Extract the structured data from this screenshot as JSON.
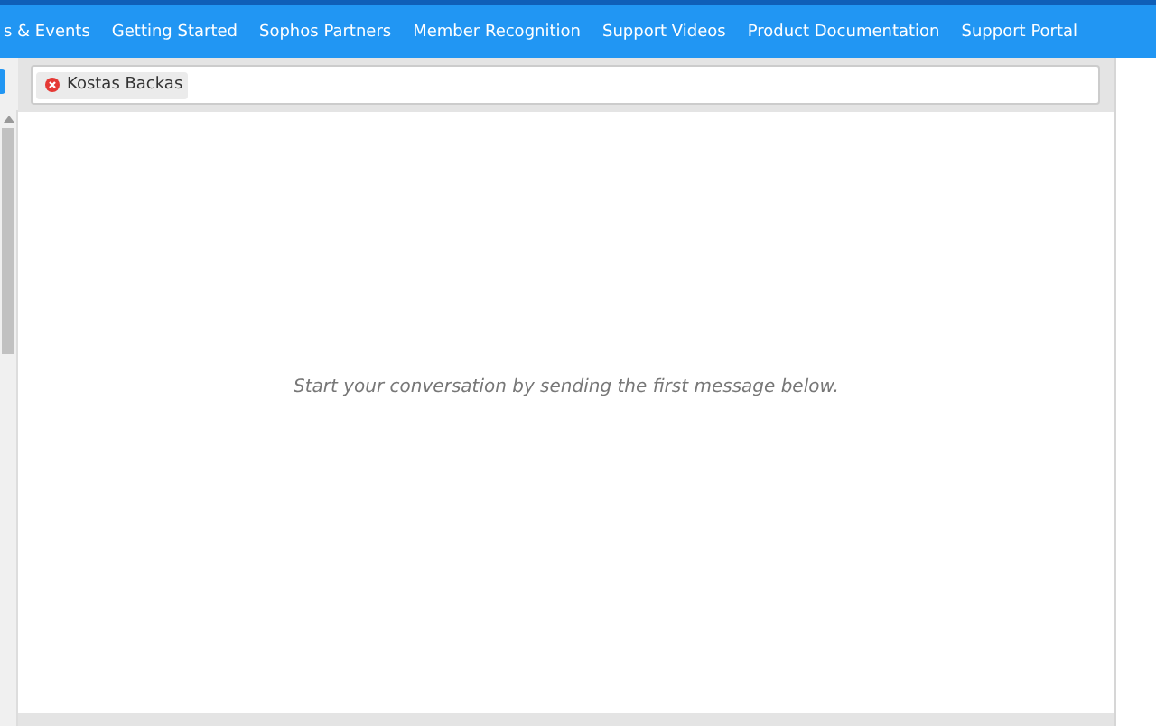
{
  "nav": {
    "items": [
      "s & Events",
      "Getting Started",
      "Sophos Partners",
      "Member Recognition",
      "Support Videos",
      "Product Documentation",
      "Support Portal"
    ]
  },
  "recipients": [
    {
      "name": "Kostas Backas"
    }
  ],
  "conversation": {
    "empty_message": "Start your conversation by sending the first message below."
  }
}
